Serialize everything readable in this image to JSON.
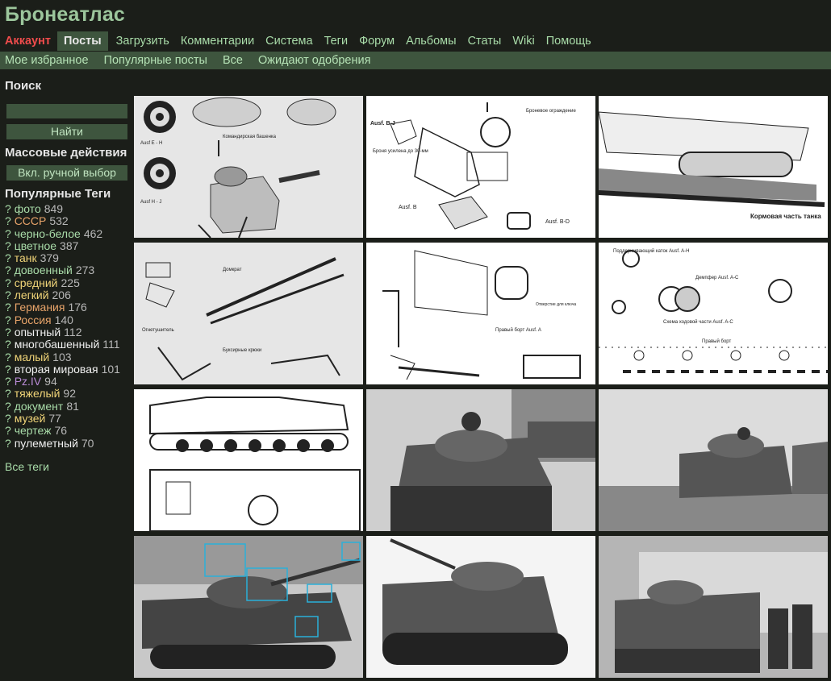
{
  "site": {
    "title": "Бронеатлас"
  },
  "nav": {
    "main": [
      "Аккаунт",
      "Посты",
      "Загрузить",
      "Комментарии",
      "Система",
      "Теги",
      "Форум",
      "Альбомы",
      "Статы",
      "Wiki",
      "Помощь"
    ],
    "sub": [
      "Мое избранное",
      "Популярные посты",
      "Все",
      "Ожидают одобрения"
    ]
  },
  "sidebar": {
    "search_heading": "Поиск",
    "search_value": "",
    "search_button": "Найти",
    "mass_actions_heading": "Массовые действия",
    "manual_select_button": "Вкл. ручной выбор",
    "popular_tags_heading": "Популярные Теги",
    "tags": [
      {
        "name": "фото",
        "count": "849",
        "color": "#a9dca9"
      },
      {
        "name": "СССР",
        "count": "532",
        "color": "#e8a46a"
      },
      {
        "name": "черно-белое",
        "count": "462",
        "color": "#a9dca9"
      },
      {
        "name": "цветное",
        "count": "387",
        "color": "#a9dca9"
      },
      {
        "name": "танк",
        "count": "379",
        "color": "#f0d478"
      },
      {
        "name": "довоенный",
        "count": "273",
        "color": "#a9dca9"
      },
      {
        "name": "средний",
        "count": "225",
        "color": "#f0d478"
      },
      {
        "name": "легкий",
        "count": "206",
        "color": "#f0d478"
      },
      {
        "name": "Германия",
        "count": "176",
        "color": "#e8a46a"
      },
      {
        "name": "Россия",
        "count": "140",
        "color": "#e8a46a"
      },
      {
        "name": "опытный",
        "count": "112",
        "color": "#f0f0f0"
      },
      {
        "name": "многобашенный",
        "count": "111",
        "color": "#f0f0f0"
      },
      {
        "name": "малый",
        "count": "103",
        "color": "#f0d478"
      },
      {
        "name": "вторая мировая",
        "count": "101",
        "color": "#f0f0f0"
      },
      {
        "name": "Pz.IV",
        "count": "94",
        "color": "#b98ad6"
      },
      {
        "name": "тяжелый",
        "count": "92",
        "color": "#f0d478"
      },
      {
        "name": "документ",
        "count": "81",
        "color": "#a9dca9"
      },
      {
        "name": "музей",
        "count": "77",
        "color": "#f0d478"
      },
      {
        "name": "чертеж",
        "count": "76",
        "color": "#a9dca9"
      },
      {
        "name": "пулеметный",
        "count": "70",
        "color": "#f0f0f0"
      }
    ],
    "all_tags_link": "Все теги"
  },
  "posts": [
    {
      "kind": "drawing",
      "labels": [
        "Ausf E - H",
        "Командирская башенка",
        "Ausf H - J"
      ]
    },
    {
      "kind": "drawing",
      "labels": [
        "Ausf. B-J",
        "Броневое ограждение",
        "Броня усилена до 30-мм",
        "Ausf. B",
        "Ausf. B-D"
      ]
    },
    {
      "kind": "drawing",
      "labels": [
        "Кормовая часть танка"
      ]
    },
    {
      "kind": "drawing",
      "labels": [
        "Огнетушитель",
        "Буксирные крюки",
        "Домкрат"
      ]
    },
    {
      "kind": "drawing",
      "labels": [
        "Правый борт Ausf. A",
        "Отверстие для ключа"
      ]
    },
    {
      "kind": "drawing",
      "labels": [
        "Поддерживающий каток Ausf. A-H",
        "Демпфер Ausf. A-C",
        "Схема ходовой части Ausf. A-C",
        "Правый борт"
      ]
    },
    {
      "kind": "blueprint",
      "labels": []
    },
    {
      "kind": "photo",
      "labels": []
    },
    {
      "kind": "photo",
      "labels": []
    },
    {
      "kind": "photo",
      "labels": []
    },
    {
      "kind": "photo",
      "labels": []
    },
    {
      "kind": "photo",
      "labels": []
    }
  ]
}
